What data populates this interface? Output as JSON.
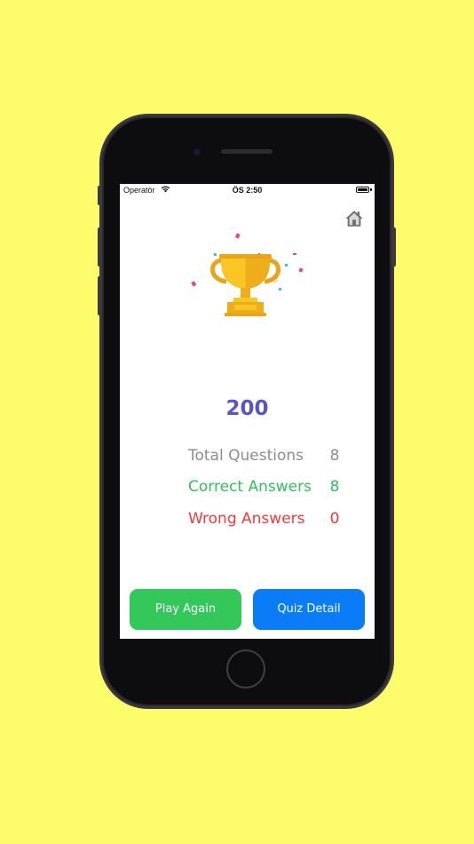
{
  "status_bar": {
    "carrier": "Operatör",
    "time": "ÖS 2:50"
  },
  "result": {
    "score": "200",
    "stats": [
      {
        "label": "Total Questions",
        "value": "8",
        "color": "#8d8d8d"
      },
      {
        "label": "Correct Answers",
        "value": "8",
        "color": "#2fc15a"
      },
      {
        "label": "Wrong Answers",
        "value": "0",
        "color": "#ee3b3b"
      }
    ]
  },
  "buttons": {
    "play_again": "Play Again",
    "quiz_detail": "Quiz Detail"
  },
  "icons": {
    "home": "home-icon",
    "trophy": "trophy-icon"
  },
  "colors": {
    "background": "#fdfd6c",
    "score": "#5a55c4",
    "play_again": "#34c759",
    "quiz_detail": "#0a7cf7"
  }
}
